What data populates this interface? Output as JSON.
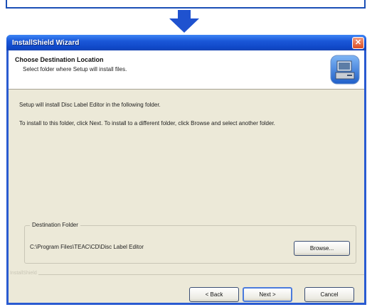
{
  "window": {
    "title": "InstallShield Wizard",
    "close_glyph": "✕"
  },
  "header": {
    "title": "Choose Destination Location",
    "subtitle": "Select folder where Setup will install files."
  },
  "body": {
    "line1": "Setup will install Disc Label Editor in the following folder.",
    "line2": "To install to this folder, click Next. To install to a different folder, click Browse and select another folder."
  },
  "destination": {
    "group_label": "Destination Folder",
    "path": "C:\\Program Files\\TEAC\\CD\\Disc Label Editor",
    "browse_label": "Browse..."
  },
  "footer": {
    "brand": "InstallShield",
    "back_label": "< Back",
    "next_label": "Next >",
    "cancel_label": "Cancel"
  },
  "icons": {
    "arrow": "down-arrow-icon",
    "header": "computer-install-icon"
  },
  "colors": {
    "titlebar": "#1a57d8",
    "window_bg": "#ece9d8",
    "close": "#db4e24",
    "arrow": "#1f52cf"
  }
}
